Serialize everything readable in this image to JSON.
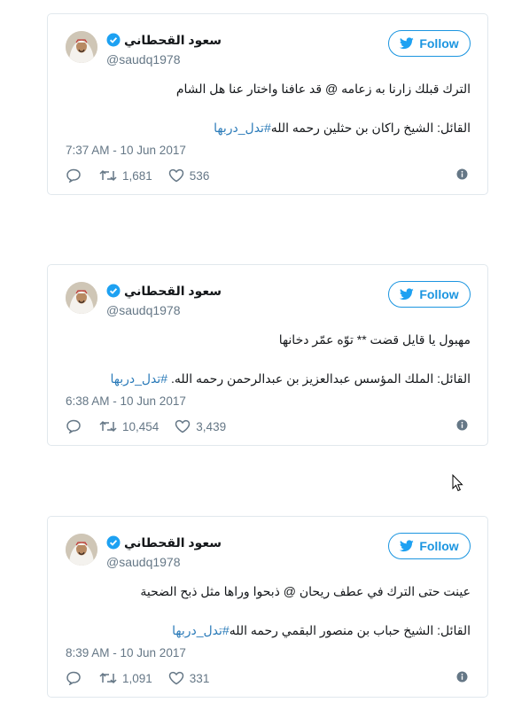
{
  "tweets": [
    {
      "name": "سعود القحطاني",
      "handle": "@saudq1978",
      "follow_label": "Follow",
      "line1": "الترك قبلك زارنا به زعامه @ قد عافنا واختار عنا هل الشام",
      "line2_text": "القائل: الشيخ راكان بن حثلين رحمه الله",
      "line2_hashtag": "#تدل_دربها",
      "timestamp": "7:37 AM - 10 Jun 2017",
      "retweets": "1,681",
      "likes": "536"
    },
    {
      "name": "سعود القحطاني",
      "handle": "@saudq1978",
      "follow_label": "Follow",
      "line1": "مهبول يا قايل قضت ** توّه عمّر دخانها",
      "line2_text": "القائل: الملك المؤسس عبدالعزيز بن عبدالرحمن رحمه الله.",
      "line2_hashtag": "#تدل_دربها",
      "timestamp": "6:38 AM - 10 Jun 2017",
      "retweets": "10,454",
      "likes": "3,439"
    },
    {
      "name": "سعود القحطاني",
      "handle": "@saudq1978",
      "follow_label": "Follow",
      "line1": "عينت حتى الترك في عطف ريحان @ ذبحوا وراها مثل ذبح الضحية",
      "line2_text": "القائل: الشيخ حباب بن منصور البقمي رحمه الله",
      "line2_hashtag": "#تدل_دربها",
      "timestamp": "8:39 AM - 10 Jun 2017",
      "retweets": "1,091",
      "likes": "331"
    }
  ],
  "colors": {
    "twitter_blue": "#1b95e0",
    "hashtag": "#2b7bb9",
    "muted": "#657786",
    "border": "#e1e8ed"
  },
  "icons": [
    "verified-badge-icon",
    "twitter-bird-icon",
    "reply-icon",
    "retweet-icon",
    "like-heart-icon",
    "info-icon",
    "mouse-cursor-icon"
  ]
}
